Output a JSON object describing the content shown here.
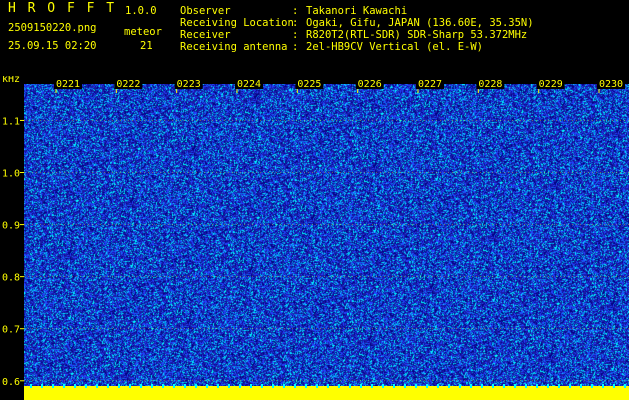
{
  "header": {
    "app_title": "H R O F F T",
    "version": "1.0.0",
    "filename": "2509150220.png",
    "datetime": "25.09.15 02:20",
    "meteor_label": "meteor",
    "meteor_count": "21",
    "info_labels": [
      "Observer",
      "Receiving Location",
      "Receiver",
      "Receiving antenna"
    ],
    "info_separator": ":",
    "info_values": [
      "Takanori Kawachi",
      "Ogaki, Gifu, JAPAN (136.60E, 35.35N)",
      "R820T2(RTL-SDR) SDR-Sharp 53.372MHz",
      "2el-HB9CV Vertical (el. E-W)"
    ]
  },
  "plot": {
    "y_unit": "kHz",
    "x_ticks": [
      "0221",
      "0222",
      "0223",
      "0224",
      "0225",
      "0226",
      "0227",
      "0228",
      "0229",
      "0230"
    ],
    "y_ticks": [
      "1.1",
      "1.0",
      "0.9",
      "0.8",
      "0.7",
      "0.6"
    ],
    "y_range_khz": [
      0.59,
      1.17
    ],
    "colors": {
      "background_noise": "#1a1aa8",
      "speckle_dark": "#000080",
      "speckle_mid": "#2244ff",
      "speckle_bright": "#00ffff",
      "baseline_band": "#ffff00",
      "gridline": "#ffff00",
      "axis_text": "#ffff00"
    }
  }
}
